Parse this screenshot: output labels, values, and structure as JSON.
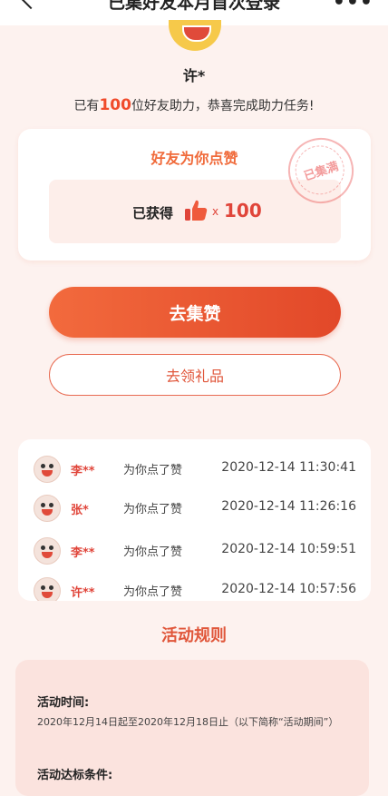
{
  "nav": {
    "title": "已集好友本月首次登录"
  },
  "user": {
    "name": "许*"
  },
  "help": {
    "prefix": "已有",
    "count": "100",
    "suffix": "位好友助力，恭喜完成助力任务!"
  },
  "like_card": {
    "title": "好友为你点赞",
    "obtained_label": "已获得",
    "times": "x",
    "count": "100",
    "stamp": "已集满"
  },
  "buttons": {
    "collect": "去集赞",
    "gift": "去领礼品"
  },
  "records": [
    {
      "name": "李**",
      "action": "为你点了赞",
      "time": "2020-12-14 11:30:41"
    },
    {
      "name": "张*",
      "action": "为你点了赞",
      "time": "2020-12-14 11:26:16"
    },
    {
      "name": "李**",
      "action": "为你点了赞",
      "time": "2020-12-14 10:59:51"
    },
    {
      "name": "许**",
      "action": "为你点了赞",
      "time": "2020-12-14 10:57:56"
    }
  ],
  "rules": {
    "title": "活动规则",
    "time_heading": "活动时间:",
    "time_text": "2020年12月14日起至2020年12月18日止（以下简称“活动期间”）",
    "condition_heading": "活动达标条件:"
  },
  "colors": {
    "accent": "#e24829",
    "background": "#fdf2ef"
  }
}
